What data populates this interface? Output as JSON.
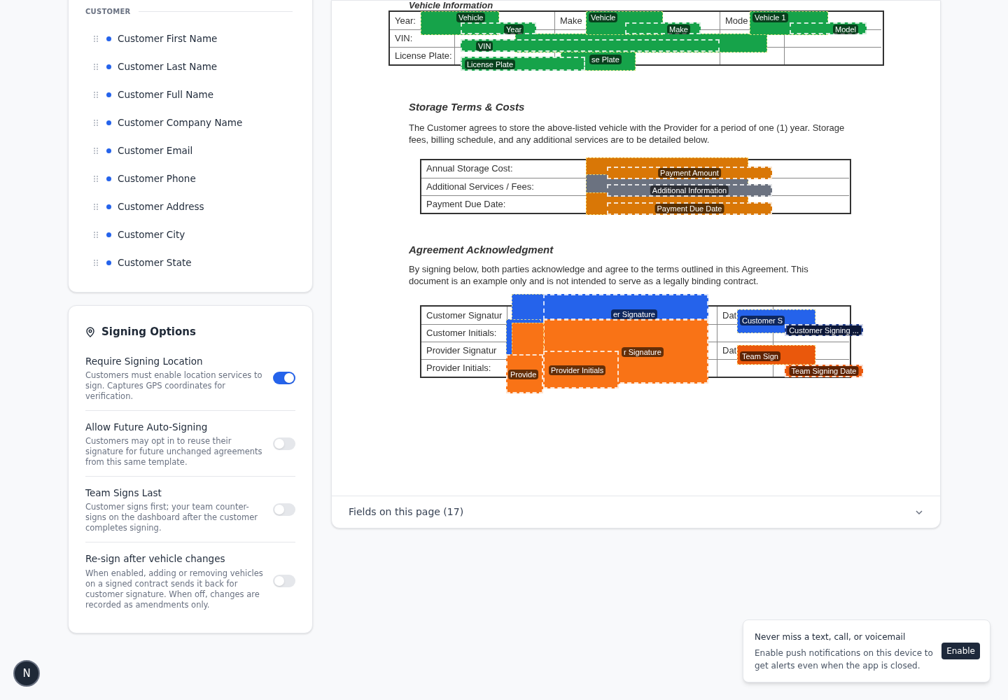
{
  "customer_fields": {
    "heading": "CUSTOMER",
    "items": [
      {
        "label": "Customer First Name"
      },
      {
        "label": "Customer Last Name"
      },
      {
        "label": "Customer Full Name"
      },
      {
        "label": "Customer Company Name"
      },
      {
        "label": "Customer Email"
      },
      {
        "label": "Customer Phone"
      },
      {
        "label": "Customer Address"
      },
      {
        "label": "Customer City"
      },
      {
        "label": "Customer State"
      }
    ]
  },
  "signing_options": {
    "title": "Signing Options",
    "options": [
      {
        "label": "Require Signing Location",
        "description": "Customers must enable location services to sign. Captures GPS coordinates for verification.",
        "on": true
      },
      {
        "label": "Allow Future Auto-Signing",
        "description": "Customers may opt in to reuse their signature for future unchanged agreements from this same template.",
        "on": false
      },
      {
        "label": "Team Signs Last",
        "description": "Customer signs first; your team counter-signs on the dashboard after the customer completes signing.",
        "on": false
      },
      {
        "label": "Re-sign after vehicle changes",
        "description": "When enabled, adding or removing vehicles on a signed contract sends it back for customer signature. When off, changes are recorded as amendments only.",
        "on": false
      }
    ]
  },
  "document": {
    "vehicle_heading": "Vehicle Information",
    "vehicle_rows": [
      [
        "Year:",
        "",
        "Make",
        "",
        "Mode",
        ""
      ],
      [
        "VIN:",
        "",
        "",
        "",
        "",
        ""
      ],
      [
        "License Plate:",
        "",
        "",
        "",
        "",
        ""
      ]
    ],
    "storage_heading": "Storage Terms & Costs",
    "storage_text": "The Customer agrees to store the above-listed vehicle with the Provider for a period of one (1) year. Storage fees, billing schedule, and any additional services are to be detailed below.",
    "storage_rows": [
      [
        "Annual Storage Cost:",
        ""
      ],
      [
        "Additional Services / Fees:",
        ""
      ],
      [
        "Payment Due Date:",
        ""
      ]
    ],
    "ack_heading": "Agreement Acknowledgment",
    "ack_text": "By signing below, both parties acknowledge and agree to the terms outlined in this Agreement. This document is an example only and is not intended to serve as a legally binding contract.",
    "signature_rows": [
      [
        "Customer Signatur",
        "",
        "Dat",
        ""
      ],
      [
        "Customer Initials:",
        "",
        "",
        ""
      ],
      [
        "Provider Signatur",
        "",
        "Dat",
        ""
      ],
      [
        "Provider Initials:",
        "",
        "",
        ""
      ]
    ]
  },
  "fields": [
    {
      "kind": "back",
      "color": "#16a34a"
    },
    {
      "kind": "back",
      "label": "se Plate",
      "color": "#16a34a"
    },
    {
      "kind": "back",
      "label": "Vehicle",
      "color": "#16a34a"
    },
    {
      "kind": "front",
      "label": "Year",
      "color": "#16a34a"
    },
    {
      "kind": "back",
      "label": "Vehicle",
      "color": "#16a34a"
    },
    {
      "kind": "front",
      "label": "Make",
      "color": "#16a34a"
    },
    {
      "kind": "back",
      "label": "Vehicle 1",
      "color": "#16a34a"
    },
    {
      "kind": "front",
      "label": "Model",
      "color": "#16a34a"
    },
    {
      "kind": "front",
      "label": "VIN",
      "color": "#16a34a"
    },
    {
      "kind": "front",
      "label": "License Plate",
      "color": "#16a34a"
    },
    {
      "kind": "back",
      "color": "#d97706"
    },
    {
      "kind": "back",
      "color": "#6b7280"
    },
    {
      "kind": "back",
      "color": "#d97706"
    },
    {
      "kind": "front",
      "label": "Payment Amount",
      "color": "#d97706"
    },
    {
      "kind": "front",
      "label": "Additional Information",
      "color": "#6b7280"
    },
    {
      "kind": "front",
      "label": "Payment Due Date",
      "color": "#d97706"
    },
    {
      "kind": "back",
      "color": "#2563eb"
    },
    {
      "kind": "front",
      "label": "er Signature",
      "color": "#2563eb"
    },
    {
      "kind": "back",
      "color": "#2563eb"
    },
    {
      "kind": "front",
      "label": "r Signature",
      "color": "#f97316"
    },
    {
      "kind": "back",
      "color": "#f97316"
    },
    {
      "kind": "front",
      "label": "Provide",
      "color": "#f97316"
    },
    {
      "kind": "front",
      "label": "Provider Initials",
      "color": "#f97316"
    },
    {
      "kind": "back",
      "label": "Customer S",
      "color": "#2563eb"
    },
    {
      "kind": "front",
      "label": "Customer Signing ...",
      "color": "#1e3a8a"
    },
    {
      "kind": "back",
      "label": "Team Sign",
      "color": "#ea580c"
    },
    {
      "kind": "front",
      "label": "Team Signing Date",
      "color": "#ea580c"
    }
  ],
  "fields_footer": {
    "label": "Fields on this page (17)",
    "expanded": false
  },
  "notification": {
    "title": "Never miss a text, call, or voicemail",
    "body": "Enable push notifications on this device to get alerts even when the app is closed.",
    "button": "Enable"
  },
  "avatar": {
    "letter": "N"
  }
}
